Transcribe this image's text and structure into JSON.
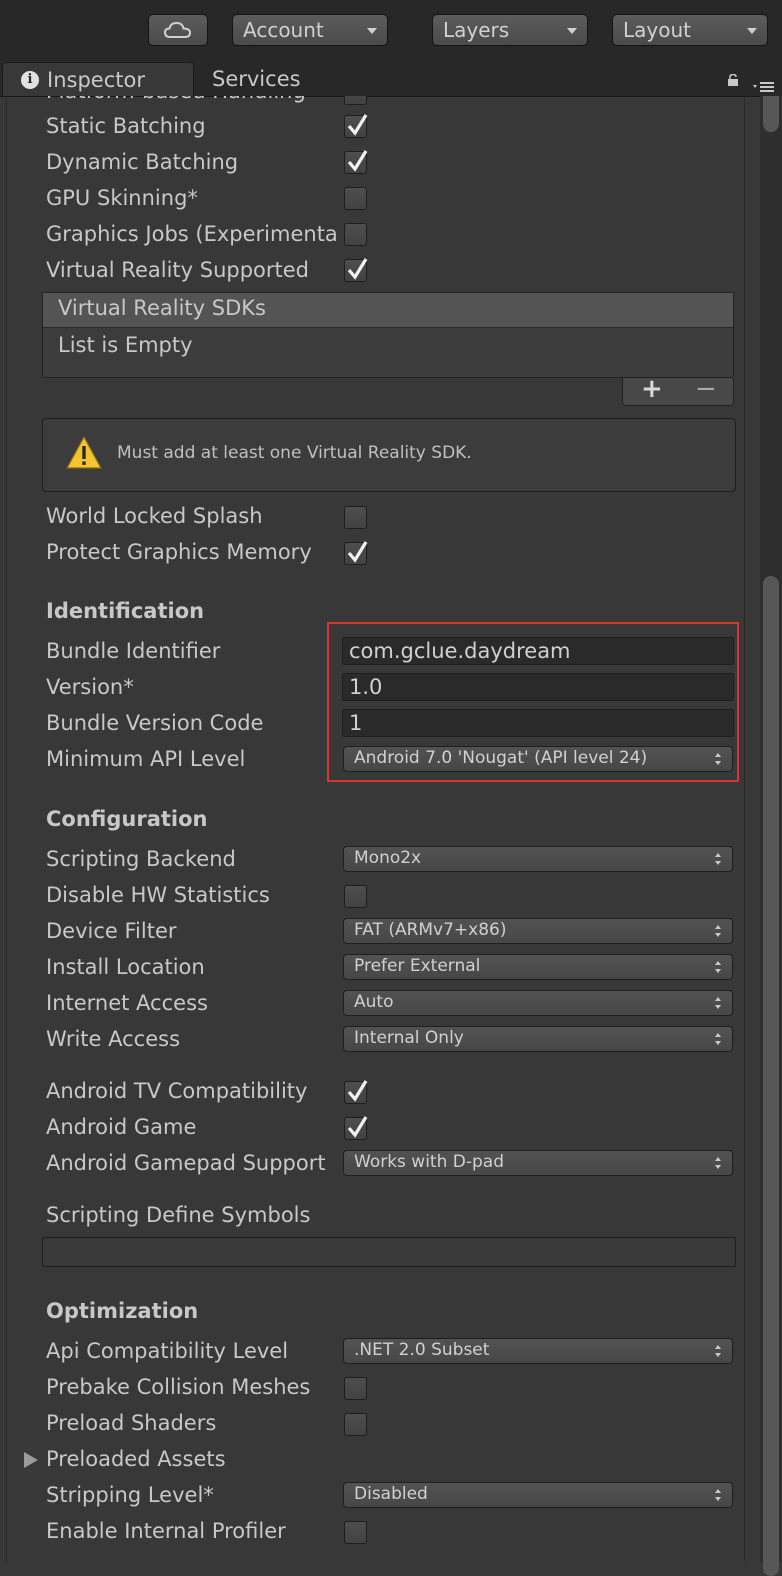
{
  "toolbar": {
    "account": "Account",
    "layers": "Layers",
    "layout": "Layout"
  },
  "tabs": {
    "inspector": "Inspector",
    "services": "Services"
  },
  "rendering": {
    "cut_off_label": "Platform-based Handling",
    "static_batching": {
      "label": "Static Batching",
      "checked": true
    },
    "dynamic_batching": {
      "label": "Dynamic Batching",
      "checked": true
    },
    "gpu_skinning": {
      "label": "GPU Skinning*",
      "checked": false
    },
    "graphics_jobs": {
      "label": "Graphics Jobs (Experimenta",
      "checked": false
    },
    "vr_supported": {
      "label": "Virtual Reality Supported",
      "checked": true
    },
    "vr_sdks_header": "Virtual Reality SDKs",
    "vr_sdks_empty": "List is Empty",
    "add_symbol": "+",
    "remove_symbol": "−",
    "warning": "Must add at least one Virtual Reality SDK.",
    "world_locked_splash": {
      "label": "World Locked Splash",
      "checked": false
    },
    "protect_graphics_memory": {
      "label": "Protect Graphics Memory",
      "checked": true
    }
  },
  "identification": {
    "header": "Identification",
    "bundle_identifier": {
      "label": "Bundle Identifier",
      "value": "com.gclue.daydream"
    },
    "version": {
      "label": "Version*",
      "value": "1.0"
    },
    "bundle_version_code": {
      "label": "Bundle Version Code",
      "value": "1"
    },
    "min_api_level": {
      "label": "Minimum API Level",
      "value": "Android 7.0 'Nougat' (API level 24)"
    }
  },
  "configuration": {
    "header": "Configuration",
    "scripting_backend": {
      "label": "Scripting Backend",
      "value": "Mono2x"
    },
    "disable_hw_stats": {
      "label": "Disable HW Statistics",
      "checked": false
    },
    "device_filter": {
      "label": "Device Filter",
      "value": "FAT (ARMv7+x86)"
    },
    "install_location": {
      "label": "Install Location",
      "value": "Prefer External"
    },
    "internet_access": {
      "label": "Internet Access",
      "value": "Auto"
    },
    "write_access": {
      "label": "Write Access",
      "value": "Internal Only"
    },
    "android_tv": {
      "label": "Android TV Compatibility",
      "checked": true
    },
    "android_game": {
      "label": "Android Game",
      "checked": true
    },
    "gamepad_support": {
      "label": "Android Gamepad Support",
      "value": "Works with D-pad"
    },
    "define_symbols": {
      "label": "Scripting Define Symbols",
      "value": ""
    }
  },
  "optimization": {
    "header": "Optimization",
    "api_compat": {
      "label": "Api Compatibility Level",
      "value": ".NET 2.0 Subset"
    },
    "prebake_collision": {
      "label": "Prebake Collision Meshes",
      "checked": false
    },
    "preload_shaders": {
      "label": "Preload Shaders",
      "checked": false
    },
    "preloaded_assets": {
      "label": "Preloaded Assets"
    },
    "stripping_level": {
      "label": "Stripping Level*",
      "value": "Disabled"
    },
    "internal_profiler": {
      "label": "Enable Internal Profiler",
      "checked": false
    }
  },
  "colors": {
    "highlight_box": "#d23a30",
    "warning_icon": "#f4c430",
    "panel_bg": "#383838"
  }
}
